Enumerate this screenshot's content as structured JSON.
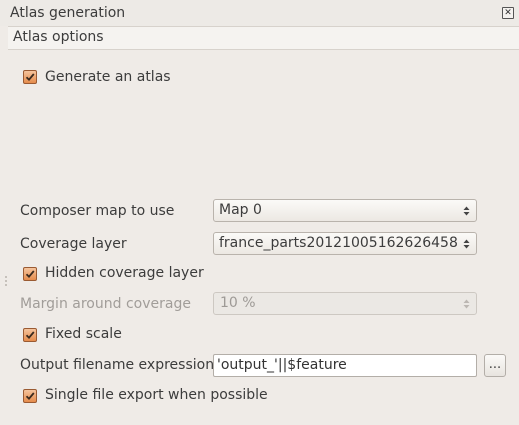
{
  "window": {
    "title": "Atlas generation",
    "close_glyph": "✕"
  },
  "section": {
    "title": "Atlas options"
  },
  "generate_atlas": {
    "label": "Generate an atlas",
    "checked": true
  },
  "composer_map": {
    "label": "Composer map to use",
    "value": "Map 0"
  },
  "coverage_layer": {
    "label": "Coverage layer",
    "value": "france_parts20121005162626458"
  },
  "hidden_coverage": {
    "label": "Hidden coverage layer",
    "checked": true
  },
  "margin": {
    "label": "Margin around coverage",
    "value": "10 %",
    "enabled": false
  },
  "fixed_scale": {
    "label": "Fixed scale",
    "checked": true
  },
  "output_filename": {
    "label": "Output filename expression",
    "value": "'output_'||$feature",
    "button_label": "..."
  },
  "single_file": {
    "label": "Single file export when possible",
    "checked": true
  },
  "colors": {
    "checkbox_fill": "#e58c4c",
    "checkbox_border": "#9a5a32",
    "background": "#efebe7"
  }
}
